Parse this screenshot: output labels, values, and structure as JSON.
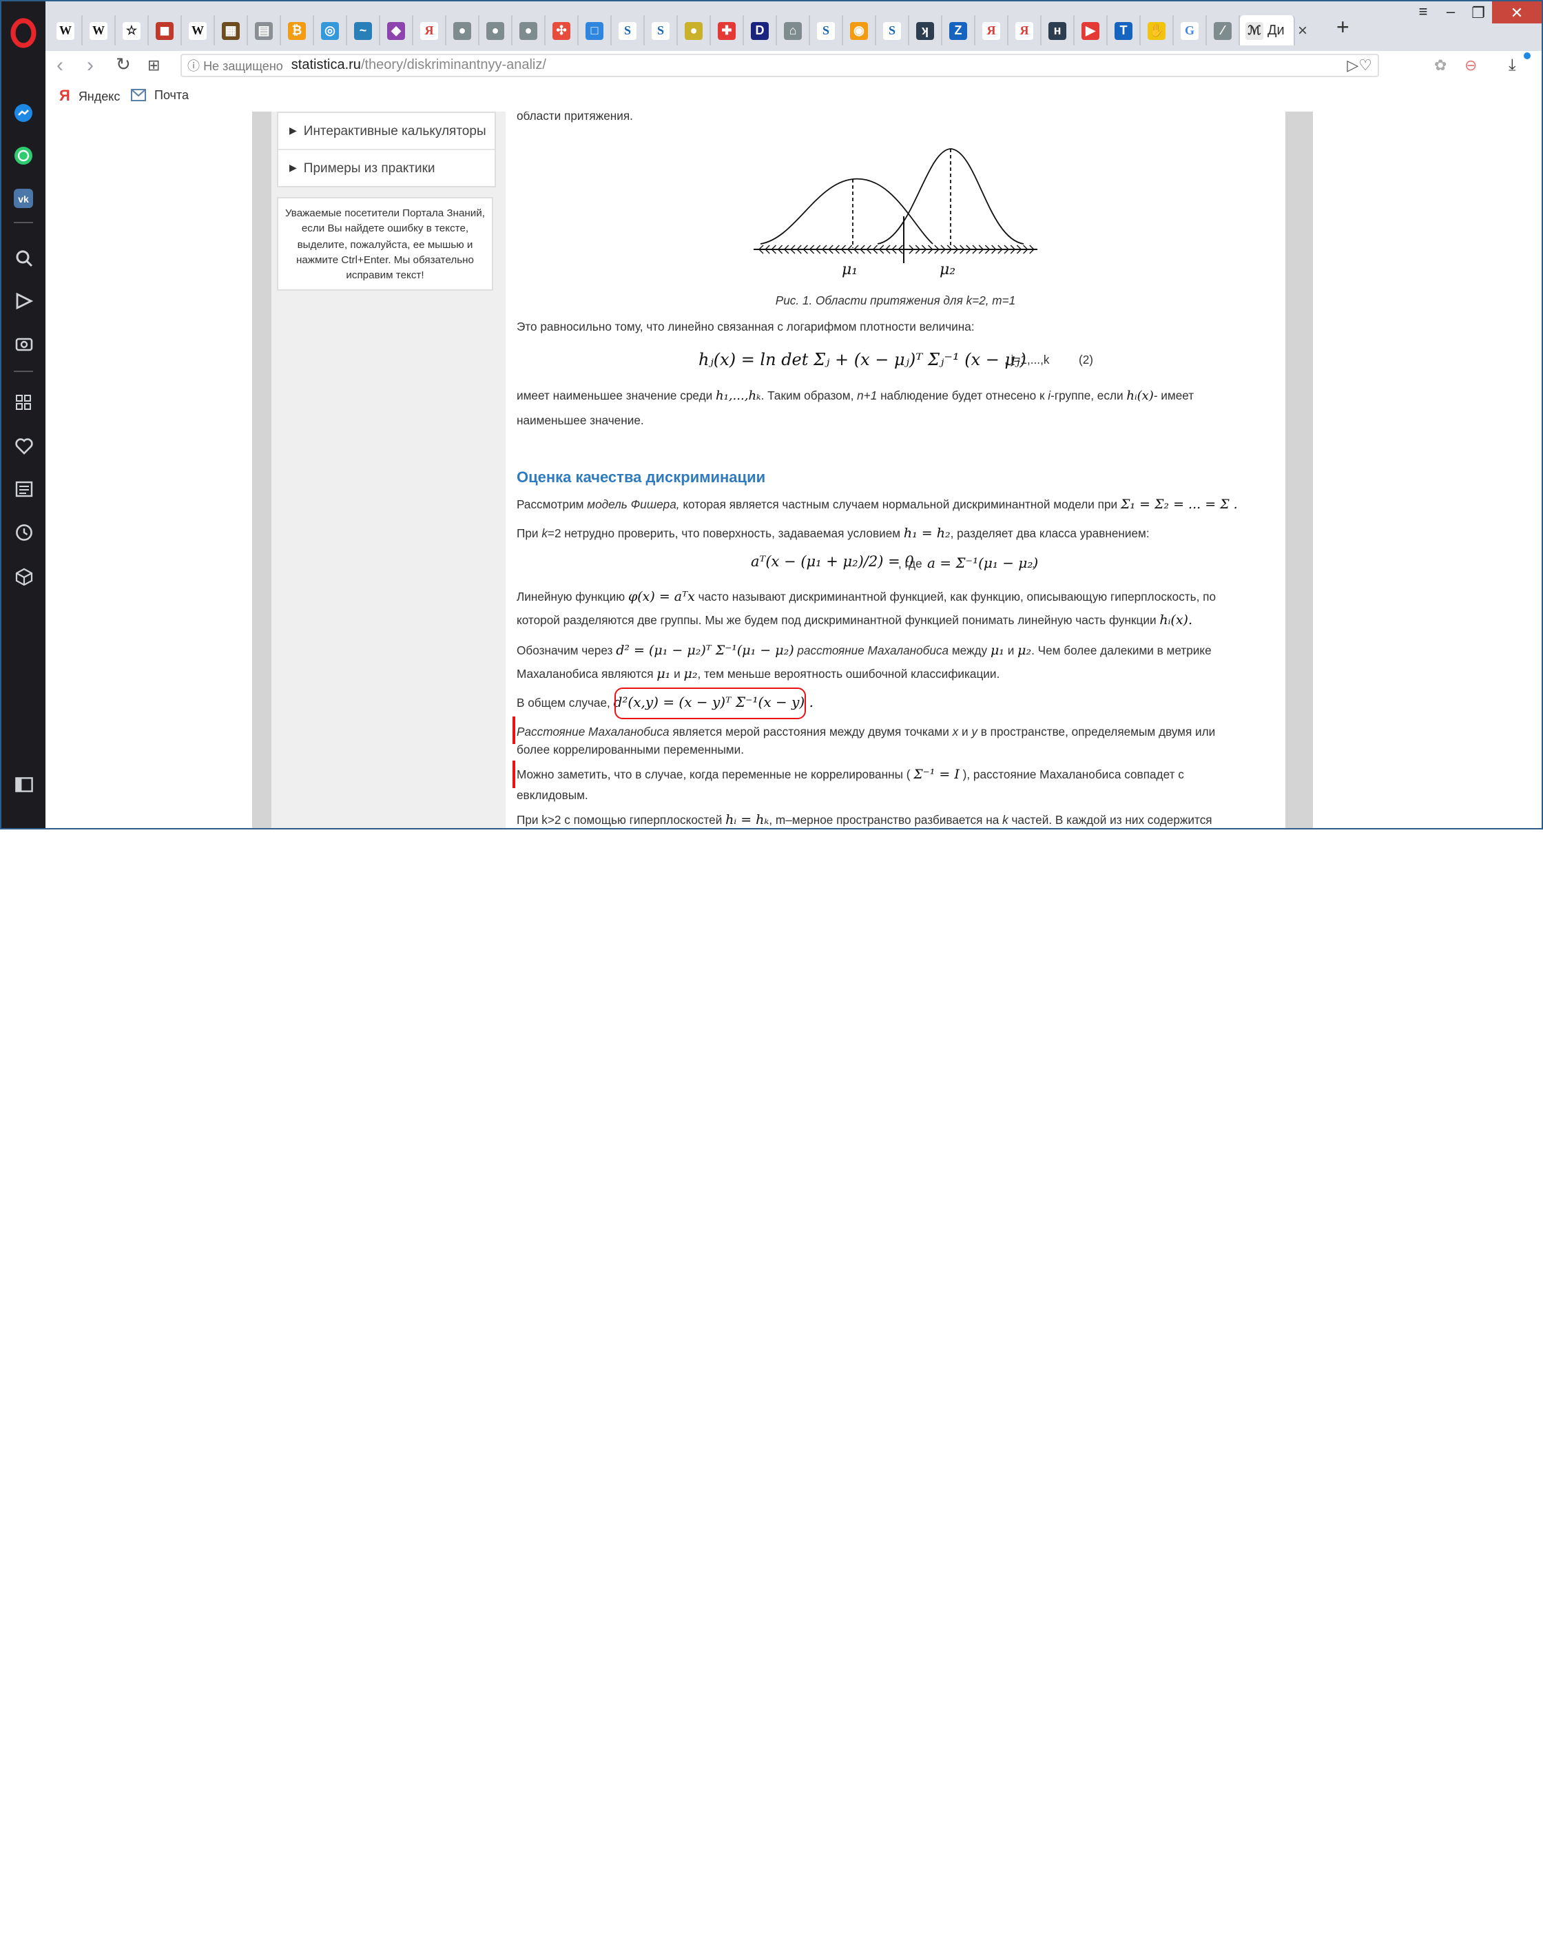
{
  "browser": {
    "tab_active_title": "Ди",
    "tab_close": "×",
    "new_tab": "+",
    "address": {
      "security": "Не защищено",
      "host": "statistica.ru",
      "path": "/theory/diskriminantnyy-analiz/"
    },
    "bookmarks": [
      {
        "label": "Яндекс",
        "icon": "yandex-icon"
      },
      {
        "label": "Почта",
        "icon": "mail-icon"
      }
    ],
    "tab_icons": [
      {
        "glyph": "W",
        "color": "#ffffff",
        "text": "#111"
      },
      {
        "glyph": "W",
        "color": "#ffffff",
        "text": "#111"
      },
      {
        "glyph": "☆",
        "color": "#ffffff",
        "text": "#111"
      },
      {
        "glyph": "◼",
        "color": "#c0392b",
        "text": "#fff"
      },
      {
        "glyph": "W",
        "color": "#ffffff",
        "text": "#111"
      },
      {
        "glyph": "▦",
        "color": "#6d4c1f",
        "text": "#fff"
      },
      {
        "glyph": "▤",
        "color": "#8a8f96",
        "text": "#fff"
      },
      {
        "glyph": "₿",
        "color": "#f39c12",
        "text": "#fff"
      },
      {
        "glyph": "◎",
        "color": "#3498db",
        "text": "#fff"
      },
      {
        "glyph": "~",
        "color": "#2980b9",
        "text": "#fff"
      },
      {
        "glyph": "◆",
        "color": "#8e44ad",
        "text": "#fff"
      },
      {
        "glyph": "Я",
        "color": "#ffffff",
        "text": "#e53935"
      },
      {
        "glyph": "●",
        "color": "#7f8c8d",
        "text": "#fff"
      },
      {
        "glyph": "●",
        "color": "#7f8c8d",
        "text": "#fff"
      },
      {
        "glyph": "●",
        "color": "#7f8c8d",
        "text": "#fff"
      },
      {
        "glyph": "✣",
        "color": "#e74c3c",
        "text": "#fff"
      },
      {
        "glyph": "□",
        "color": "#2e86de",
        "text": "#fff"
      },
      {
        "glyph": "S",
        "color": "#ffffff",
        "text": "#1565c0"
      },
      {
        "glyph": "S",
        "color": "#ffffff",
        "text": "#1565c0"
      },
      {
        "glyph": "●",
        "color": "#c9b12a",
        "text": "#fff"
      },
      {
        "glyph": "✚",
        "color": "#e53935",
        "text": "#fff"
      },
      {
        "glyph": "D",
        "color": "#1a237e",
        "text": "#fff"
      },
      {
        "glyph": "⌂",
        "color": "#7f8c8d",
        "text": "#fff"
      },
      {
        "glyph": "S",
        "color": "#ffffff",
        "text": "#1565c0"
      },
      {
        "glyph": "◉",
        "color": "#f39c12",
        "text": "#fff"
      },
      {
        "glyph": "S",
        "color": "#ffffff",
        "text": "#1565c0"
      },
      {
        "glyph": "ʞ",
        "color": "#2c3e50",
        "text": "#fff"
      },
      {
        "glyph": "Z",
        "color": "#1565c0",
        "text": "#fff"
      },
      {
        "glyph": "Я",
        "color": "#ffffff",
        "text": "#e53935"
      },
      {
        "glyph": "Я",
        "color": "#ffffff",
        "text": "#e53935"
      },
      {
        "glyph": "ʜ",
        "color": "#2c3e50",
        "text": "#fff"
      },
      {
        "glyph": "▶",
        "color": "#e53935",
        "text": "#fff"
      },
      {
        "glyph": "T",
        "color": "#1565c0",
        "text": "#fff"
      },
      {
        "glyph": "✋",
        "color": "#f1c40f",
        "text": "#fff"
      },
      {
        "glyph": "G",
        "color": "#ffffff",
        "text": "#4285f4"
      },
      {
        "glyph": "⁄",
        "color": "#7f8c8d",
        "text": "#fff"
      }
    ],
    "rail_icons": [
      "messenger-icon",
      "whatsapp-icon",
      "vk-icon",
      "search-icon",
      "send-icon",
      "camera-icon",
      "speed-dial-icon",
      "heart-icon",
      "news-icon",
      "history-icon",
      "cube-icon",
      "sidebar-toggle-icon"
    ]
  },
  "sidebar": {
    "menu": [
      "Интерактивные калькуляторы",
      "Примеры из практики"
    ],
    "notice": "Уважаемые посетители Портала Знаний, если Вы найдете ошибку в тексте, выделите, пожалуйста, ее мышью и нажмите Ctrl+Enter. Мы обязательно исправим текст!"
  },
  "article": {
    "top_fragment": "области притяжения.",
    "figure": {
      "label_mu1": "μ₁",
      "label_mu2": "μ₂",
      "caption": "Рис. 1. Области притяжения для k=2, m=1"
    },
    "p_log_density": "Это равносильно тому, что линейно связанная с логарифмом плотности величина:",
    "formula2": "hⱼ(x) = ln det Σⱼ + (x − μⱼ)ᵀ Σⱼ⁻¹ (x − μⱼ)",
    "formula2_suffix": ", j=1,...,k",
    "formula2_number": "(2)",
    "p_min_1": "имеет наименьшее значение среди",
    "p_min_h": "h₁,...,hₖ",
    "p_min_2": ". Таким образом,",
    "p_min_n1": "n+1",
    "p_min_3": "наблюдение будет отнесено к",
    "p_min_i": "i",
    "p_min_4": "-группе, если",
    "p_min_hi": "hᵢ(x)",
    "p_min_5": "- имеет",
    "p_min_line2": "наименьшее значение.",
    "heading": "Оценка качества дискриминации",
    "p_fisher_1": "Рассмотрим",
    "p_fisher_model": "модель Фишера,",
    "p_fisher_2": "которая является частным случаем нормальной дискриминантной модели при",
    "p_fisher_formula": "Σ₁ = Σ₂ = ... = Σ .",
    "p_k2_1": "При",
    "p_k2_k": "k",
    "p_k2_2": "=2 нетрудно проверить, что поверхность, задаваемая условием",
    "p_k2_formula": "h₁ = h₂",
    "p_k2_3": ", разделяет два класса уравнением:",
    "formula_plane": "aᵀ(x − (μ₁ + μ₂)/2) = 0",
    "formula_plane_where": ", где",
    "formula_a": "a = Σ⁻¹(μ₁ − μ₂)",
    "formula_a_dot": ".",
    "p_linear_1": "Линейную функцию",
    "p_linear_formula": "φ(x) = aᵀx",
    "p_linear_2": "часто называют дискриминантной функцией, как функцию, описывающую гиперплоскость, по",
    "p_linear_line2a": "которой разделяются две группы. Мы же будем под дискриминантной функцией понимать линейную часть функции",
    "p_linear_line2f": "hᵢ(x).",
    "p_maha_1": "Обозначим через",
    "p_maha_formula": "d² = (μ₁ − μ₂)ᵀ Σ⁻¹(μ₁ − μ₂)",
    "p_maha_term": "расстояние Махаланобиса",
    "p_maha_2": "между",
    "p_maha_mu1": "μ₁",
    "p_maha_and": "и",
    "p_maha_mu2": "μ₂",
    "p_maha_3": ". Чем более далекими в метрике",
    "p_maha_line2a": "Махаланобиса являются",
    "p_maha_line2b": "μ₁",
    "p_maha_line2c": "и",
    "p_maha_line2d": "μ₂",
    "p_maha_line2e": ", тем меньше вероятность ошибочной классификации.",
    "p_general_1": "В общем случае,",
    "p_general_formula": "d²(x,y) = (x − y)ᵀ Σ⁻¹(x − y) .",
    "p_dist_term": "Расстояние Махаланобиса",
    "p_dist_1": "является мерой расстояния между двумя точками",
    "p_dist_x": "x",
    "p_dist_and": "и",
    "p_dist_y": "y",
    "p_dist_2": "в пространстве, определяемым двумя или",
    "p_dist_line2": "более коррелированными переменными.",
    "p_euclid_1": "Можно заметить, что в случае, когда переменные не коррелированны (",
    "p_euclid_formula": "Σ⁻¹ = I",
    "p_euclid_2": "), расстояние Махаланобиса совпадет с",
    "p_euclid_line2": "евклидовым.",
    "p_bottom_1": "При k>2 с помощью гиперплоскостей",
    "p_bottom_formula": "hᵢ = hₖ",
    "p_bottom_2": ", m–мерное пространство разбивается на",
    "p_bottom_k": "k",
    "p_bottom_3": "частей. В каждой из них содержится"
  },
  "colors": {
    "heading": "#2f7bbf",
    "annotation": "#ee1111",
    "rail": "#1c1c20",
    "opera": "#e6262b"
  }
}
